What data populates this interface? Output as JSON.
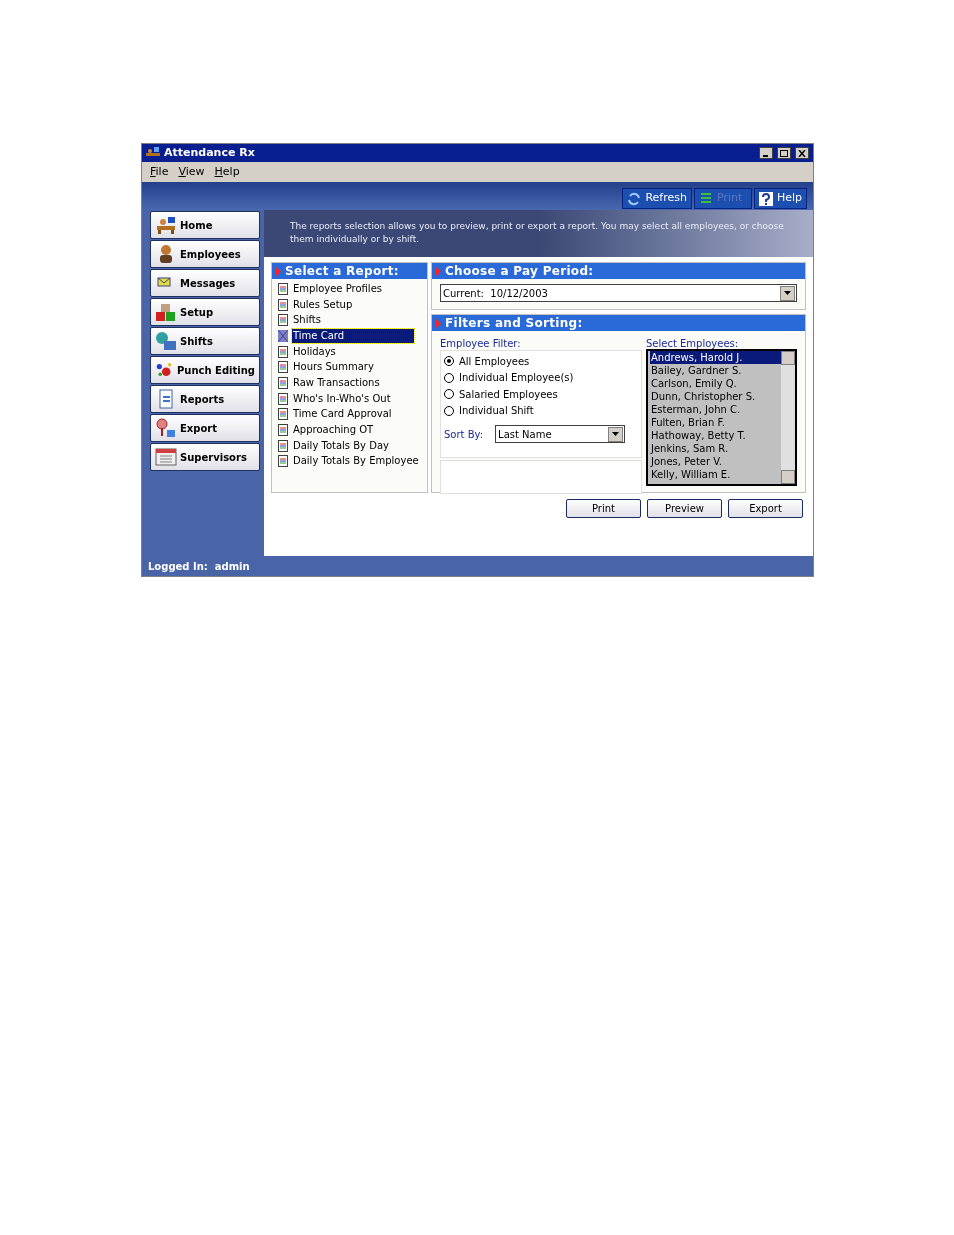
{
  "window": {
    "title": "Attendance Rx"
  },
  "menu": [
    {
      "label": "File"
    },
    {
      "label": "View"
    },
    {
      "label": "Help"
    }
  ],
  "toolbar": [
    {
      "label": "Refresh",
      "kind": "refresh",
      "disabled": false
    },
    {
      "label": "Print",
      "kind": "print",
      "disabled": true
    },
    {
      "label": "Help",
      "kind": "help",
      "disabled": false
    }
  ],
  "sidebar": {
    "items": [
      {
        "label": "Home",
        "kind": "home"
      },
      {
        "label": "Employees",
        "kind": "employees"
      },
      {
        "label": "Messages",
        "kind": "messages"
      },
      {
        "label": "Setup",
        "kind": "setup"
      },
      {
        "label": "Shifts",
        "kind": "shifts"
      },
      {
        "label": "Punch Editing",
        "kind": "punch"
      },
      {
        "label": "Reports",
        "kind": "reports"
      },
      {
        "label": "Export",
        "kind": "export"
      },
      {
        "label": "Supervisors",
        "kind": "supervisors"
      }
    ]
  },
  "description": "The reports selection allows you to preview, print or export a report.  You may select all employees, or choose them individually or by shift.",
  "reports": {
    "title": "Select a Report:",
    "items": [
      {
        "label": "Employee Profiles",
        "selected": false
      },
      {
        "label": "Rules Setup",
        "selected": false
      },
      {
        "label": "Shifts",
        "selected": false
      },
      {
        "label": "Time Card",
        "selected": true
      },
      {
        "label": "Holidays",
        "selected": false
      },
      {
        "label": "Hours Summary",
        "selected": false
      },
      {
        "label": "Raw Transactions",
        "selected": false
      },
      {
        "label": "Who's In-Who's Out",
        "selected": false
      },
      {
        "label": "Time Card Approval",
        "selected": false
      },
      {
        "label": "Approaching OT",
        "selected": false
      },
      {
        "label": "Daily Totals By Day",
        "selected": false
      },
      {
        "label": "Daily Totals By Employee",
        "selected": false
      }
    ]
  },
  "pay_period": {
    "title": "Choose a Pay Period:",
    "value": "Current:  10/12/2003"
  },
  "filters": {
    "title": "Filters and Sorting:",
    "filter_label": "Employee Filter:",
    "options": [
      {
        "label": "All Employees",
        "selected": true
      },
      {
        "label": "Individual Employee(s)",
        "selected": false
      },
      {
        "label": "Salaried Employees",
        "selected": false
      },
      {
        "label": "Individual Shift",
        "selected": false
      }
    ],
    "sort_label": "Sort By:",
    "sort_value": "Last Name",
    "employees_label": "Select Employees:",
    "employees": [
      {
        "label": "Andrews, Harold J.",
        "selected": true
      },
      {
        "label": "Bailey, Gardner S.",
        "selected": false
      },
      {
        "label": "Carlson, Emily Q.",
        "selected": false
      },
      {
        "label": "Dunn, Christopher S.",
        "selected": false
      },
      {
        "label": "Esterman, John C.",
        "selected": false
      },
      {
        "label": "Fulten, Brian F.",
        "selected": false
      },
      {
        "label": "Hathoway, Betty T.",
        "selected": false
      },
      {
        "label": "Jenkins, Sam R.",
        "selected": false
      },
      {
        "label": "Jones, Peter V.",
        "selected": false
      },
      {
        "label": "Kelly, William E.",
        "selected": false
      }
    ]
  },
  "buttons": [
    "Print",
    "Preview",
    "Export"
  ],
  "status_bar": "Logged In:  admin"
}
